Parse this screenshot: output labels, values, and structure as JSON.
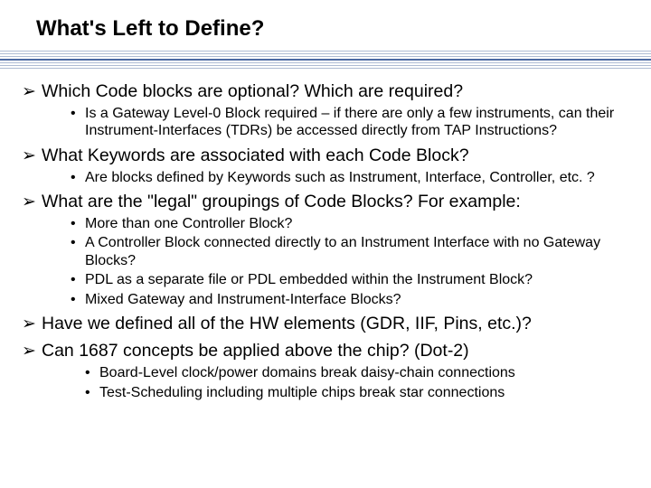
{
  "title": "What's Left to Define?",
  "items": [
    {
      "text": "Which Code blocks are optional? Which are required?",
      "subs": [
        "Is a Gateway Level-0 Block required – if there are only a few instruments, can their Instrument-Interfaces (TDRs) be accessed directly from TAP Instructions?"
      ]
    },
    {
      "text": "What Keywords are associated with each Code Block?",
      "subs": [
        "Are blocks defined by Keywords such as Instrument, Interface, Controller, etc. ?"
      ]
    },
    {
      "text": "What are the \"legal\" groupings of Code Blocks? For example:",
      "subs": [
        "More than one Controller Block?",
        "A Controller Block connected directly to an Instrument Interface with no Gateway Blocks?",
        "PDL as a separate file or PDL embedded within the Instrument Block?",
        "Mixed Gateway and Instrument-Interface Blocks?"
      ]
    },
    {
      "text": "Have we defined all of the HW elements (GDR, IIF, Pins, etc.)?",
      "subs": []
    },
    {
      "text": " Can 1687 concepts be applied above the chip? (Dot-2)",
      "subs": [
        "Board-Level clock/power domains break daisy-chain connections",
        "Test-Scheduling including multiple chips break star connections"
      ],
      "indent": true
    }
  ]
}
